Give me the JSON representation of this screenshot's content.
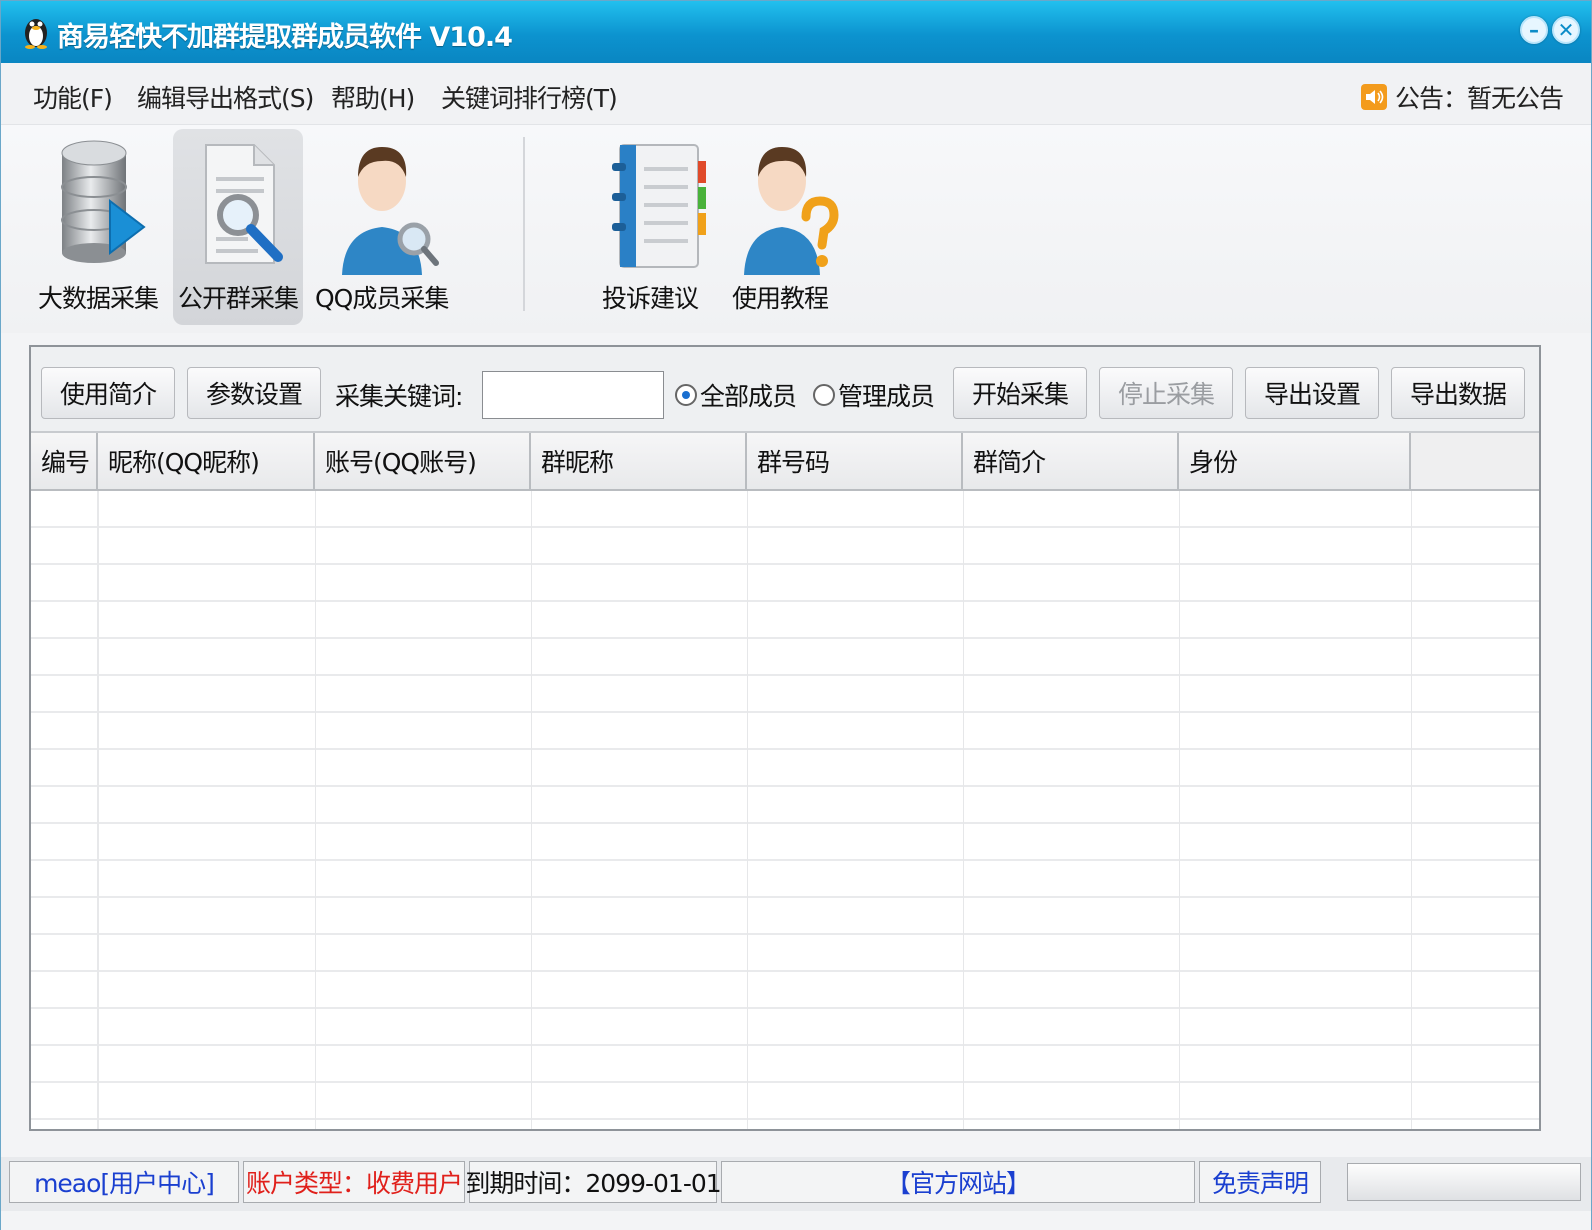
{
  "window": {
    "title": "商易轻快不加群提取群成员软件    V10.4",
    "minimize_glyph": "–",
    "close_glyph": "✕"
  },
  "menu": {
    "items": [
      "功能(F)",
      "编辑导出格式(S)",
      "帮助(H)",
      "关键词排行榜(T)"
    ],
    "notice": "公告：暂无公告"
  },
  "toolbar": {
    "tools": [
      {
        "label": "大数据采集",
        "icon": "database-icon",
        "active": false
      },
      {
        "label": "公开群采集",
        "icon": "document-search-icon",
        "active": true
      },
      {
        "label": "QQ成员采集",
        "icon": "user-search-icon",
        "active": false
      },
      {
        "label": "投诉建议",
        "icon": "notebook-icon",
        "active": false
      },
      {
        "label": "使用教程",
        "icon": "user-help-icon",
        "active": false
      }
    ]
  },
  "controls": {
    "intro_button": "使用简介",
    "settings_button": "参数设置",
    "keyword_label": "采集关键词:",
    "keyword_value": "",
    "radio_all": "全部成员",
    "radio_admin": "管理成员",
    "selected_radio": "all",
    "start_button": "开始采集",
    "stop_button": "停止采集",
    "export_settings_button": "导出设置",
    "export_data_button": "导出数据"
  },
  "table": {
    "columns": [
      "编号",
      "昵称(QQ昵称)",
      "账号(QQ账号)",
      "群昵称",
      "群号码",
      "群简介",
      "身份"
    ],
    "rows": []
  },
  "status": {
    "user": "meao[用户中心]",
    "account_type": "账户类型：收费用户",
    "expiry": "到期时间：2099-01-01",
    "website": "【官方网站】",
    "disclaimer": "免责声明"
  },
  "colors": {
    "titlebar": "#0c93cf",
    "link_blue": "#1a3fd0",
    "alert_red": "#e0201b",
    "notice_orange": "#f39b1c"
  }
}
